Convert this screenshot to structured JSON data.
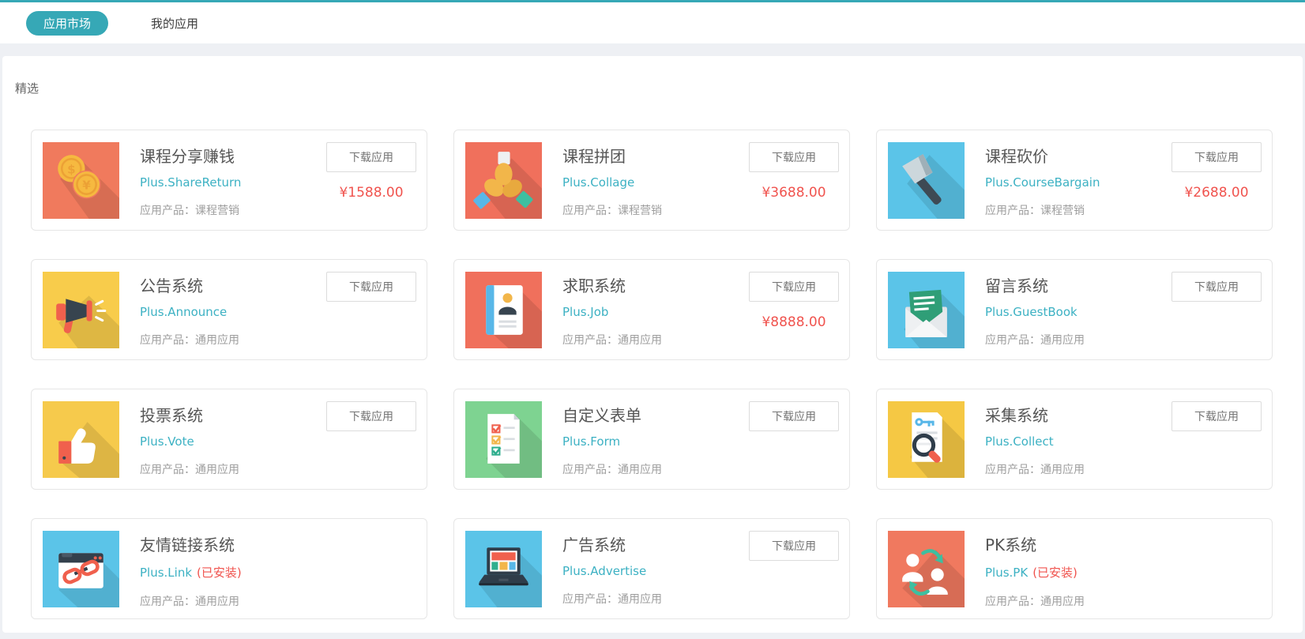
{
  "header": {
    "tabs": [
      {
        "label": "应用市场",
        "active": true
      },
      {
        "label": "我的应用",
        "active": false
      }
    ]
  },
  "section_title": "精选",
  "labels": {
    "download": "下载应用",
    "installed": "(已安装)"
  },
  "colors": {
    "accent_teal": "#36a8b6",
    "link_teal": "#3cb1c3",
    "price_red": "#f0534e",
    "card_border": "#e6e6e6",
    "page_bg": "#eef0f4"
  },
  "apps": [
    {
      "name": "课程分享赚钱",
      "package": "Plus.ShareReturn",
      "product": "应用产品：课程营销",
      "price": "¥1588.00",
      "installed": false,
      "icon": "coins-icon",
      "icon_bg": "#f07a5d"
    },
    {
      "name": "课程拼团",
      "package": "Plus.Collage",
      "product": "应用产品：课程营销",
      "price": "¥3688.00",
      "installed": false,
      "icon": "hands-together-icon",
      "icon_bg": "#f0705c"
    },
    {
      "name": "课程砍价",
      "package": "Plus.CourseBargain",
      "product": "应用产品：课程营销",
      "price": "¥2688.00",
      "installed": false,
      "icon": "axe-icon",
      "icon_bg": "#5bc4e8"
    },
    {
      "name": "公告系统",
      "package": "Plus.Announce",
      "product": "应用产品：通用应用",
      "price": "",
      "installed": false,
      "icon": "megaphone-icon",
      "icon_bg": "#f8cc4b"
    },
    {
      "name": "求职系统",
      "package": "Plus.Job",
      "product": "应用产品：通用应用",
      "price": "¥8888.00",
      "installed": false,
      "icon": "resume-icon",
      "icon_bg": "#f0705c"
    },
    {
      "name": "留言系统",
      "package": "Plus.GuestBook",
      "product": "应用产品：通用应用",
      "price": "",
      "installed": false,
      "icon": "envelope-icon",
      "icon_bg": "#5bc4e8"
    },
    {
      "name": "投票系统",
      "package": "Plus.Vote",
      "product": "应用产品：通用应用",
      "price": "",
      "installed": false,
      "icon": "thumbs-up-icon",
      "icon_bg": "#f6ca4c"
    },
    {
      "name": "自定义表单",
      "package": "Plus.Form",
      "product": "应用产品：通用应用",
      "price": "",
      "installed": false,
      "icon": "checklist-icon",
      "icon_bg": "#7ed391"
    },
    {
      "name": "采集系统",
      "package": "Plus.Collect",
      "product": "应用产品：通用应用",
      "price": "",
      "installed": false,
      "icon": "magnifier-doc-icon",
      "icon_bg": "#f5c844"
    },
    {
      "name": "友情链接系统",
      "package": "Plus.Link",
      "product": "应用产品：通用应用",
      "price": "",
      "installed": true,
      "icon": "chain-link-icon",
      "icon_bg": "#5bc4e8"
    },
    {
      "name": "广告系统",
      "package": "Plus.Advertise",
      "product": "应用产品：通用应用",
      "price": "",
      "installed": false,
      "icon": "laptop-ad-icon",
      "icon_bg": "#5bc4e8"
    },
    {
      "name": "PK系统",
      "package": "Plus.PK",
      "product": "应用产品：通用应用",
      "price": "",
      "installed": true,
      "icon": "people-swap-icon",
      "icon_bg": "#f0795f"
    }
  ]
}
